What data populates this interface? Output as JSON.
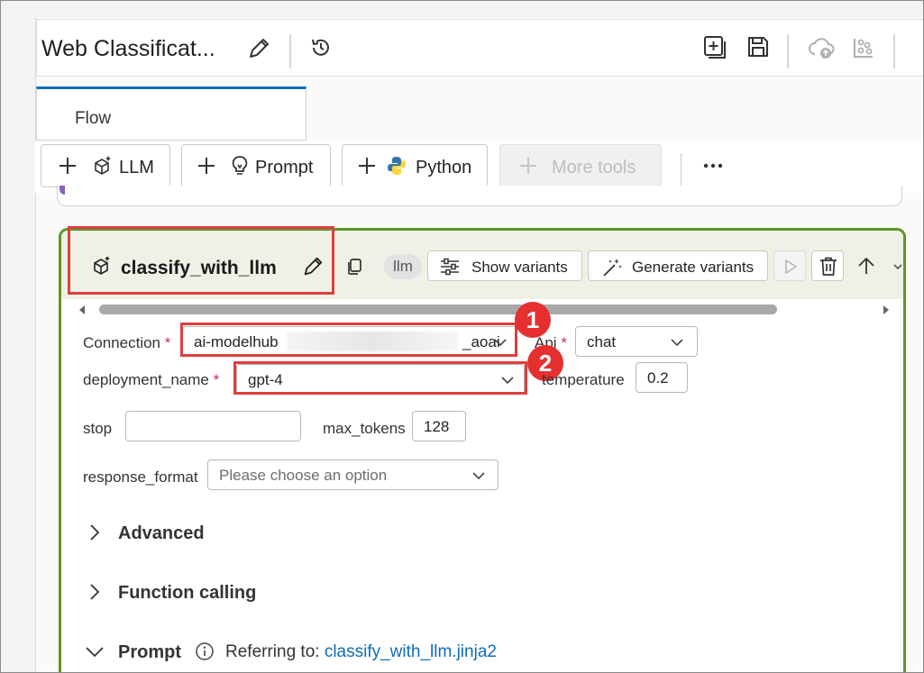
{
  "app": {
    "title": "Web Classificat...",
    "active_tab": "Flow"
  },
  "toolbar": {
    "llm_label": "LLM",
    "prompt_label": "Prompt",
    "python_label": "Python",
    "more_tools_label": "More tools"
  },
  "node": {
    "name": "classify_with_llm",
    "type_tag": "llm",
    "show_variants_label": "Show variants",
    "generate_variants_label": "Generate variants"
  },
  "inputs": {
    "connection_label": "Connection",
    "connection_value_start": "ai-modelhub",
    "connection_value_end": "_aoai",
    "api_label": "Api",
    "api_value": "chat",
    "deployment_label": "deployment_name",
    "deployment_value": "gpt-4",
    "temperature_label": "temperature",
    "temperature_value": "0.2",
    "stop_label": "stop",
    "stop_value": "",
    "max_tokens_label": "max_tokens",
    "max_tokens_value": "128",
    "response_format_label": "response_format",
    "response_format_placeholder": "Please choose an option",
    "required_mark": "*"
  },
  "sections": {
    "advanced": "Advanced",
    "function_calling": "Function calling",
    "prompt": "Prompt",
    "referring_to_label": "Referring to:",
    "referring_to_file": "classify_with_llm.jinja2"
  },
  "annotations": {
    "badge_1": "1",
    "badge_2": "2"
  },
  "colors": {
    "accent": "#0f6cbd",
    "node_border": "#5c9728",
    "highlight_red": "#e03e3e"
  }
}
